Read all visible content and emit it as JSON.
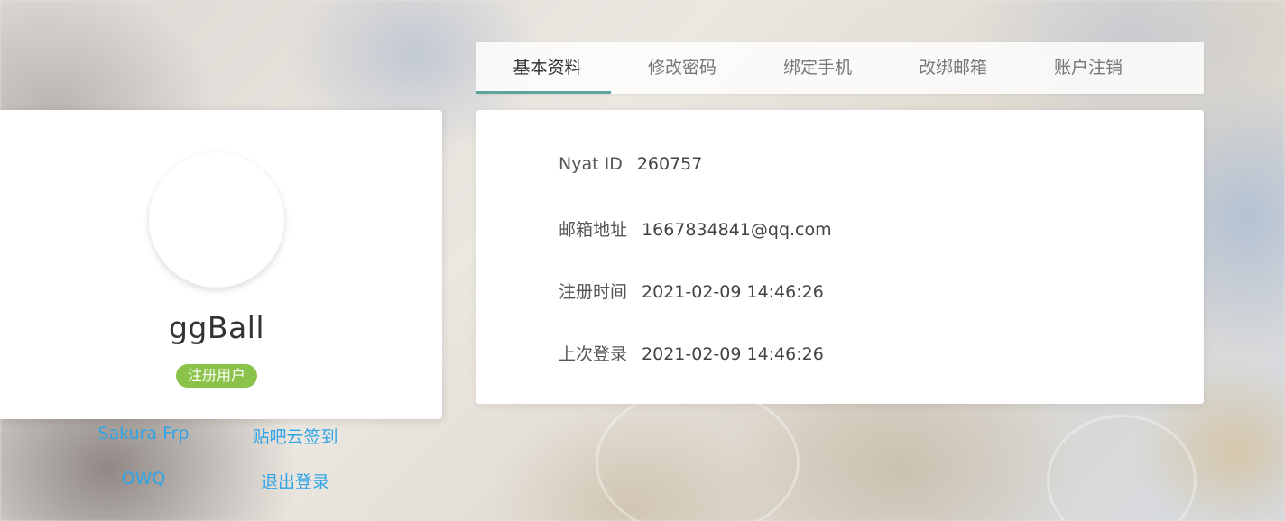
{
  "profile": {
    "username": "ggBall",
    "badge": "注册用户",
    "links": [
      {
        "icon": "link-icon",
        "glyph": "",
        "label": "Sakura Frp"
      },
      {
        "icon": "link-icon",
        "glyph": "",
        "label": "贴吧云签到"
      },
      {
        "icon": "link-icon",
        "glyph": "",
        "label": "OWQ"
      },
      {
        "icon": "logout-icon",
        "glyph": "",
        "label": "退出登录"
      }
    ]
  },
  "tabs": [
    {
      "icon": "user-icon",
      "glyph": "",
      "label": "基本资料",
      "active": true
    },
    {
      "icon": "lock-icon",
      "glyph": "",
      "label": "修改密码",
      "active": false
    },
    {
      "icon": "phone-icon",
      "glyph": "",
      "label": "绑定手机",
      "active": false
    },
    {
      "icon": "mail-icon",
      "glyph": "",
      "label": "改绑邮箱",
      "active": false
    },
    {
      "icon": "trash-icon",
      "glyph": "",
      "label": "账户注销",
      "active": false
    }
  ],
  "info": [
    {
      "label": "Nyat ID",
      "value": "260757"
    },
    {
      "label": "邮箱地址",
      "value": "1667834841@qq.com"
    },
    {
      "label": "注册时间",
      "value": "2021-02-09 14:46:26"
    },
    {
      "label": "上次登录",
      "value": "2021-02-09 14:46:26"
    }
  ],
  "colors": {
    "accent_link": "#2fa4e7",
    "badge_bg": "#8bc34a",
    "tab_active_underline": "#5fa49c"
  }
}
